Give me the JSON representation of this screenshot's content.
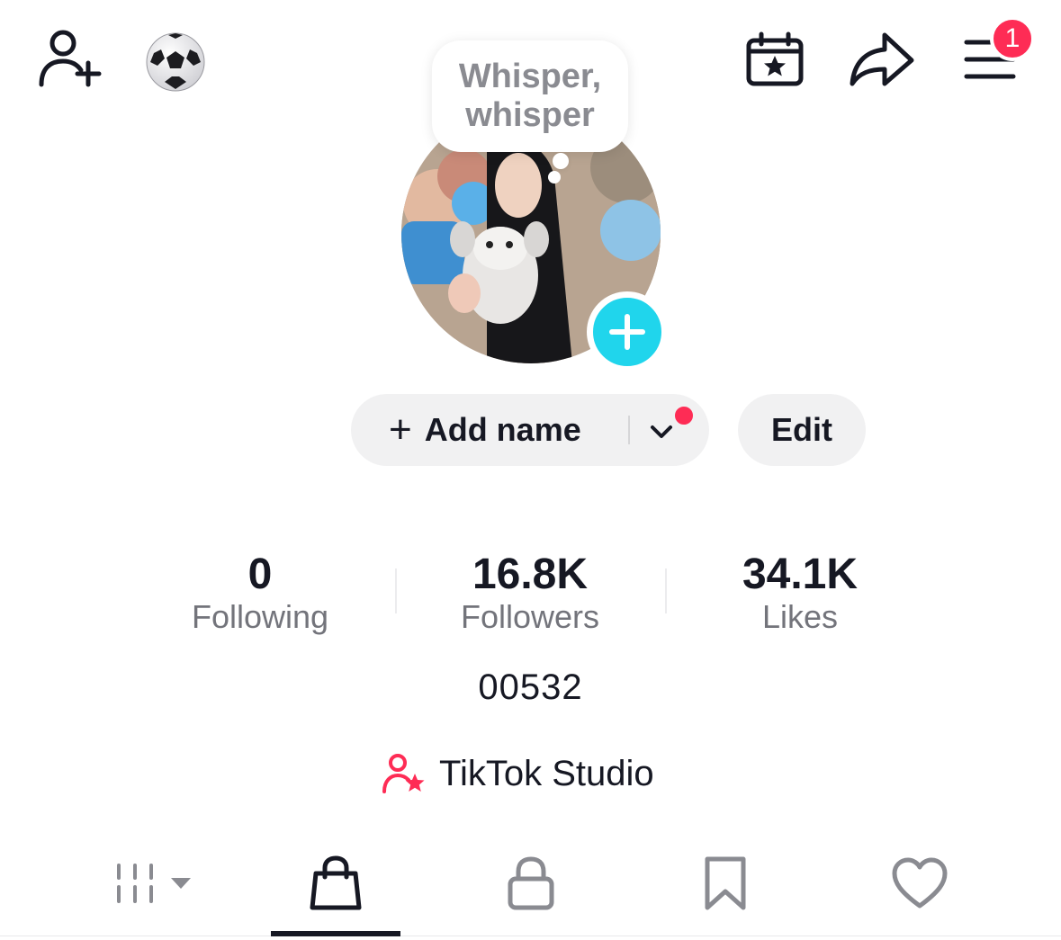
{
  "top_bar": {
    "add_friend_icon": "person-plus-icon",
    "emoji_icon": "soccer-ball-icon",
    "calendar_icon": "calendar-star-icon",
    "share_icon": "share-arrow-icon",
    "menu_icon": "hamburger-menu-icon",
    "menu_badge_count": "1"
  },
  "note_bubble": {
    "line1": "Whisper,",
    "line2": "whisper"
  },
  "profile": {
    "add_name_label": "Add name",
    "edit_label": "Edit"
  },
  "stats": [
    {
      "value": "0",
      "label": "Following"
    },
    {
      "value": "16.8K",
      "label": "Followers"
    },
    {
      "value": "34.1K",
      "label": "Likes"
    }
  ],
  "username": "00532",
  "studio": {
    "label": "TikTok Studio",
    "icon": "person-star-icon"
  },
  "tabs": [
    {
      "icon": "grid-dropdown-icon",
      "active": false
    },
    {
      "icon": "shopping-bag-icon",
      "active": true
    },
    {
      "icon": "lock-icon",
      "active": false
    },
    {
      "icon": "bookmark-icon",
      "active": false
    },
    {
      "icon": "heart-icon",
      "active": false
    }
  ],
  "colors": {
    "accent_red": "#fe2c55",
    "accent_cyan": "#20d5ec",
    "text_primary": "#161823",
    "text_secondary": "#73747b",
    "button_bg": "#f1f1f2"
  }
}
